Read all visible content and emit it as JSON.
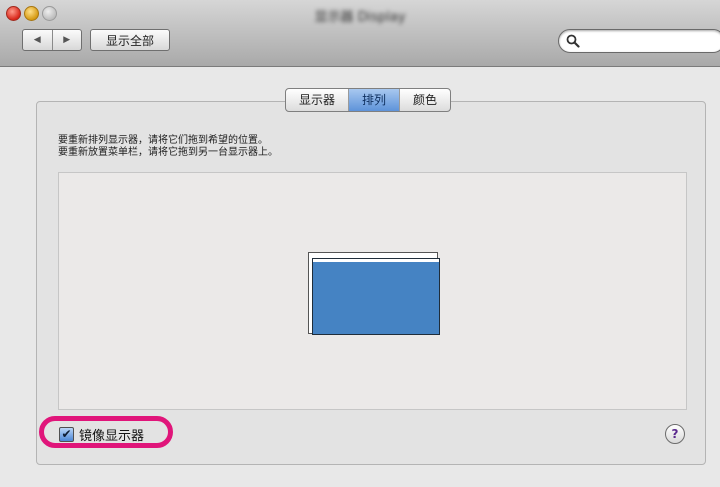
{
  "window": {
    "title": "显示器 Display"
  },
  "toolbar": {
    "back_glyph": "◀",
    "forward_glyph": "▶",
    "show_all_label": "显示全部",
    "search_value": "",
    "search_icon": "magnifier-icon"
  },
  "tabs": [
    {
      "label": "显示器",
      "active": false
    },
    {
      "label": "排列",
      "active": true
    },
    {
      "label": "颜色",
      "active": false
    }
  ],
  "instructions": {
    "line1": "要重新排列显示器，请将它们拖到希望的位置。",
    "line2": "要重新放置菜单栏，请将它拖到另一台显示器上。"
  },
  "arrangement": {
    "display_color": "#4583c3"
  },
  "mirror": {
    "label": "镜像显示器",
    "checked": true,
    "check_glyph": "✔",
    "highlight_color": "#e0157a"
  },
  "help": {
    "glyph": "?"
  }
}
